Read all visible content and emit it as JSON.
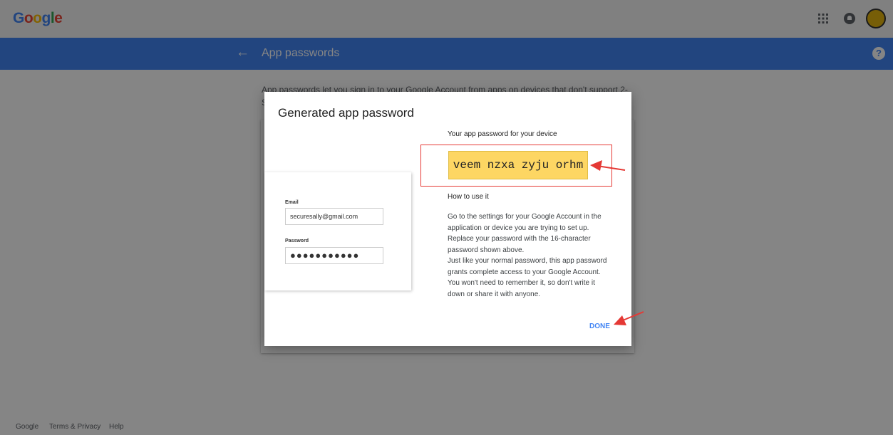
{
  "header": {
    "logo": "Google",
    "icons": [
      "apps-icon",
      "notifications-icon",
      "avatar"
    ]
  },
  "nav": {
    "back": "←",
    "title": "App passwords",
    "help": "?"
  },
  "intro_text": "App passwords let you sign in to your Google Account from apps on devices that don't support 2-Step V",
  "dialog": {
    "title": "Generated app password",
    "password_heading": "Your app password for your device",
    "password": "veem nzxa zyju orhm",
    "howto_heading": "How to use it",
    "howto_paragraph_1": "Go to the settings for your Google Account in the application or device you are trying to set up. Replace your password with the 16-character password shown above.",
    "howto_paragraph_2": "Just like your normal password, this app password grants complete access to your Google Account. You won't need to remember it, so don't write it down or share it with anyone.",
    "done_label": "DONE",
    "illustration": {
      "email_label": "Email",
      "email_value": "securesally@gmail.com",
      "password_label": "Password",
      "password_value": "●●●●●●●●●●●"
    }
  },
  "footer": {
    "google": "Google",
    "terms": "Terms & Privacy",
    "help": "Help"
  },
  "colors": {
    "blue": "#4285f4",
    "highlight": "#fdd663",
    "annotation_red": "#e53935"
  }
}
